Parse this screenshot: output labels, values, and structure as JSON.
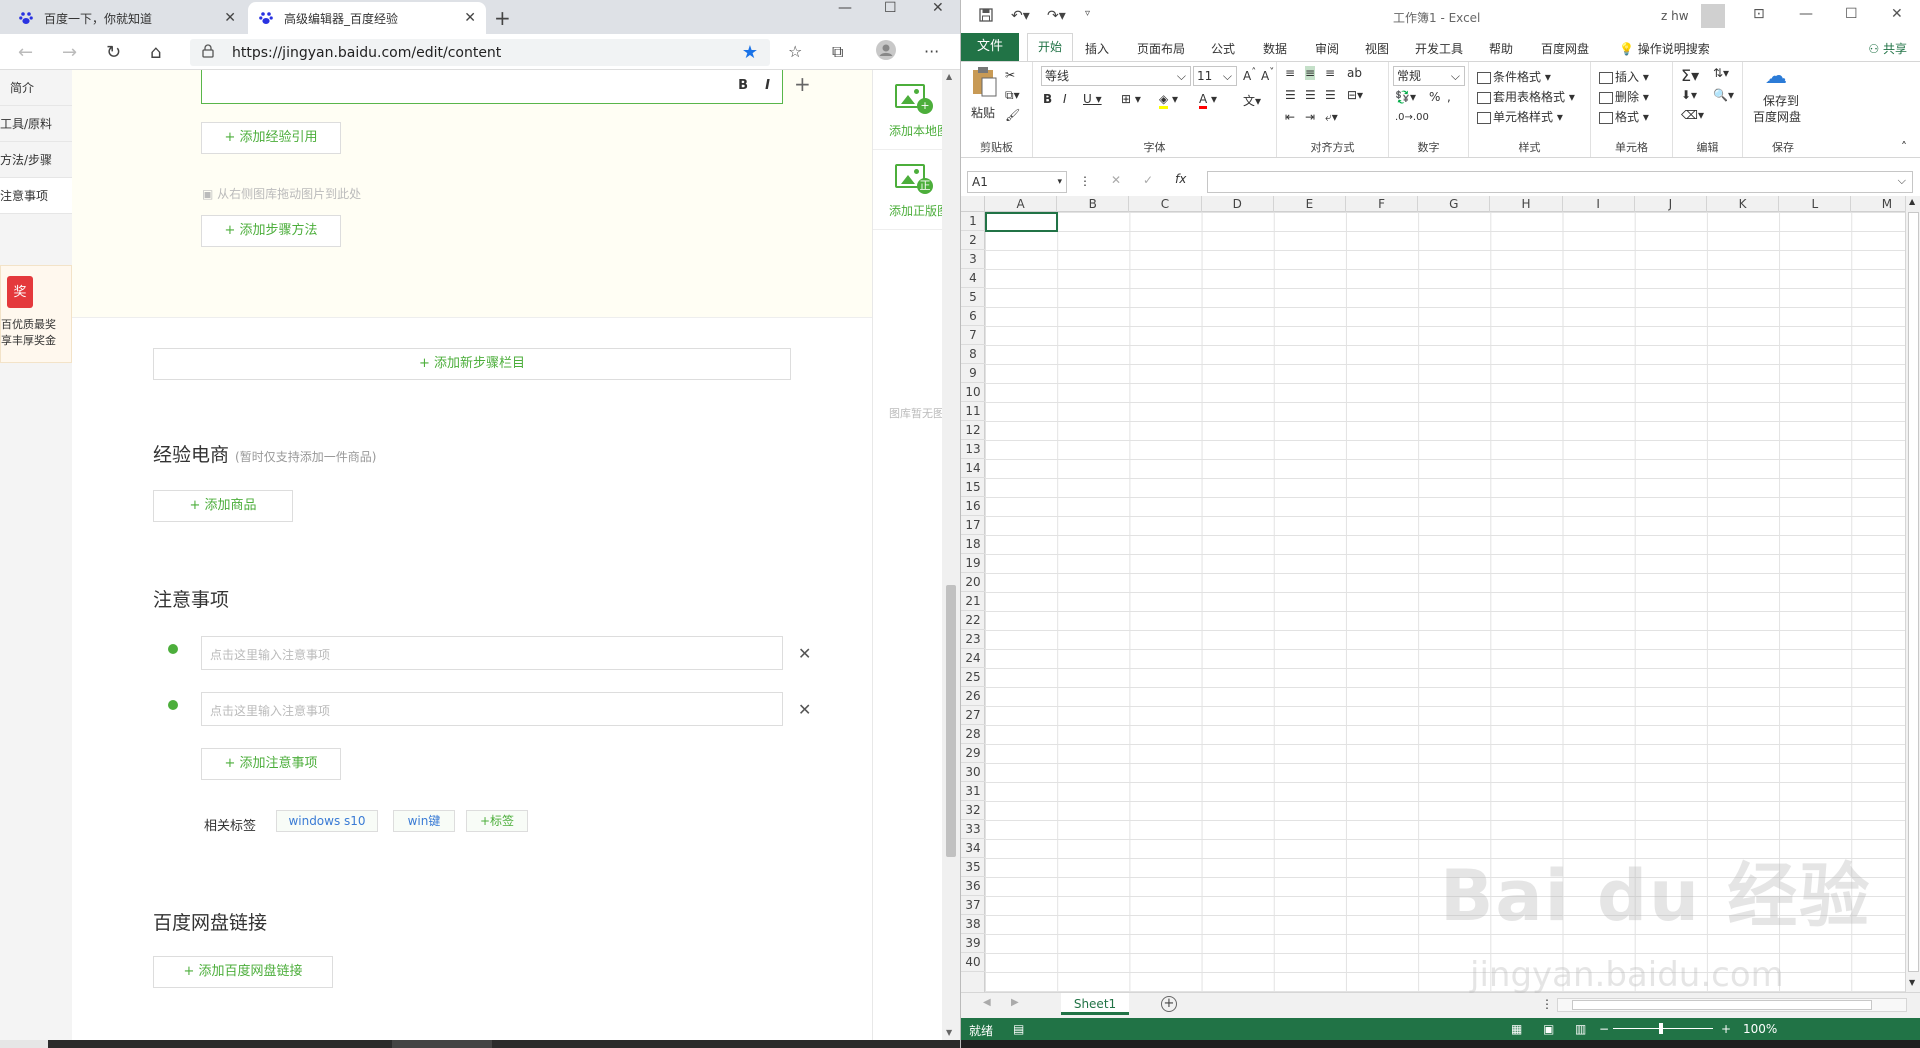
{
  "browser": {
    "tabs": [
      {
        "title": "百度一下，你就知道",
        "active": false
      },
      {
        "title": "高级编辑器_百度经验",
        "active": true
      }
    ],
    "url": "https://jingyan.baidu.com/edit/content",
    "window_controls": [
      "—",
      "☐",
      "✕"
    ]
  },
  "leftnav": {
    "items": [
      {
        "label": "简介",
        "active": false
      },
      {
        "label": "工具/原料",
        "active": false
      },
      {
        "label": "方法/步骤",
        "active": false
      },
      {
        "label": "注意事项",
        "active": true
      }
    ],
    "award": {
      "icon_text": "奖",
      "line1": "百优质最奖",
      "line2": "享丰厚奖金"
    }
  },
  "editor": {
    "bold_label": "B",
    "italic_label": "I",
    "add_quote": "+ 添加经验引用",
    "drag_hint": "从右侧图库拖动图片到此处",
    "add_step_method": "+ 添加步骤方法",
    "add_step_section": "+ 添加新步骤栏目"
  },
  "ecommerce": {
    "title": "经验电商",
    "subtitle": "(暂时仅支持添加一件商品)",
    "add_product": "+ 添加商品"
  },
  "notes": {
    "title": "注意事项",
    "placeholder": "点击这里输入注意事项",
    "add_note": "+ 添加注意事项",
    "tags_label": "相关标签",
    "tags": [
      "windows s10",
      "win键",
      "+标签"
    ]
  },
  "netdisk": {
    "title": "百度网盘链接",
    "add_link": "+ 添加百度网盘链接"
  },
  "rightpanel": {
    "add_local": "添加本地图",
    "add_copyright": "添加正版图",
    "empty": "图库暂无图"
  },
  "excel": {
    "doc_title": "工作簿1  -  Excel",
    "user": "z hw",
    "menu": {
      "file": "文件",
      "home": "开始",
      "items": [
        "插入",
        "页面布局",
        "公式",
        "数据",
        "审阅",
        "视图",
        "开发工具",
        "帮助",
        "百度网盘",
        "操作说明搜索"
      ],
      "share": "共享"
    },
    "ribbon": {
      "clipboard": {
        "paste": "粘贴",
        "label": "剪贴板"
      },
      "font": {
        "name": "等线",
        "size": "11",
        "label": "字体"
      },
      "align": {
        "label": "对齐方式"
      },
      "number": {
        "format": "常规",
        "label": "数字"
      },
      "styles": {
        "cond": "条件格式",
        "table": "套用表格格式",
        "cell": "单元格样式",
        "label": "样式"
      },
      "cells": {
        "insert": "插入",
        "delete": "删除",
        "format": "格式",
        "label": "单元格"
      },
      "edit": {
        "label": "编辑"
      },
      "save": {
        "line1": "保存到",
        "line2": "百度网盘",
        "label": "保存"
      }
    },
    "namebox": "A1",
    "columns": [
      "A",
      "B",
      "C",
      "D",
      "E",
      "F",
      "G",
      "H",
      "I",
      "J",
      "K",
      "L",
      "M"
    ],
    "rows": [
      "1",
      "2",
      "3",
      "4",
      "5",
      "6",
      "7",
      "8",
      "9",
      "10",
      "11",
      "12",
      "13",
      "14",
      "15",
      "16",
      "17",
      "18",
      "19",
      "20",
      "21",
      "22",
      "23",
      "24",
      "25",
      "26",
      "27",
      "28",
      "29",
      "30",
      "31",
      "32",
      "33",
      "34",
      "35",
      "36",
      "37",
      "38",
      "39",
      "40"
    ],
    "sheet": "Sheet1",
    "status": "就绪",
    "zoom": "100%"
  },
  "watermark": {
    "main": "Bai  du 经验",
    "sub": "jingyan.baidu.com"
  },
  "colors": {
    "baidu_green": "#4cae3b",
    "excel_green": "#217346"
  }
}
